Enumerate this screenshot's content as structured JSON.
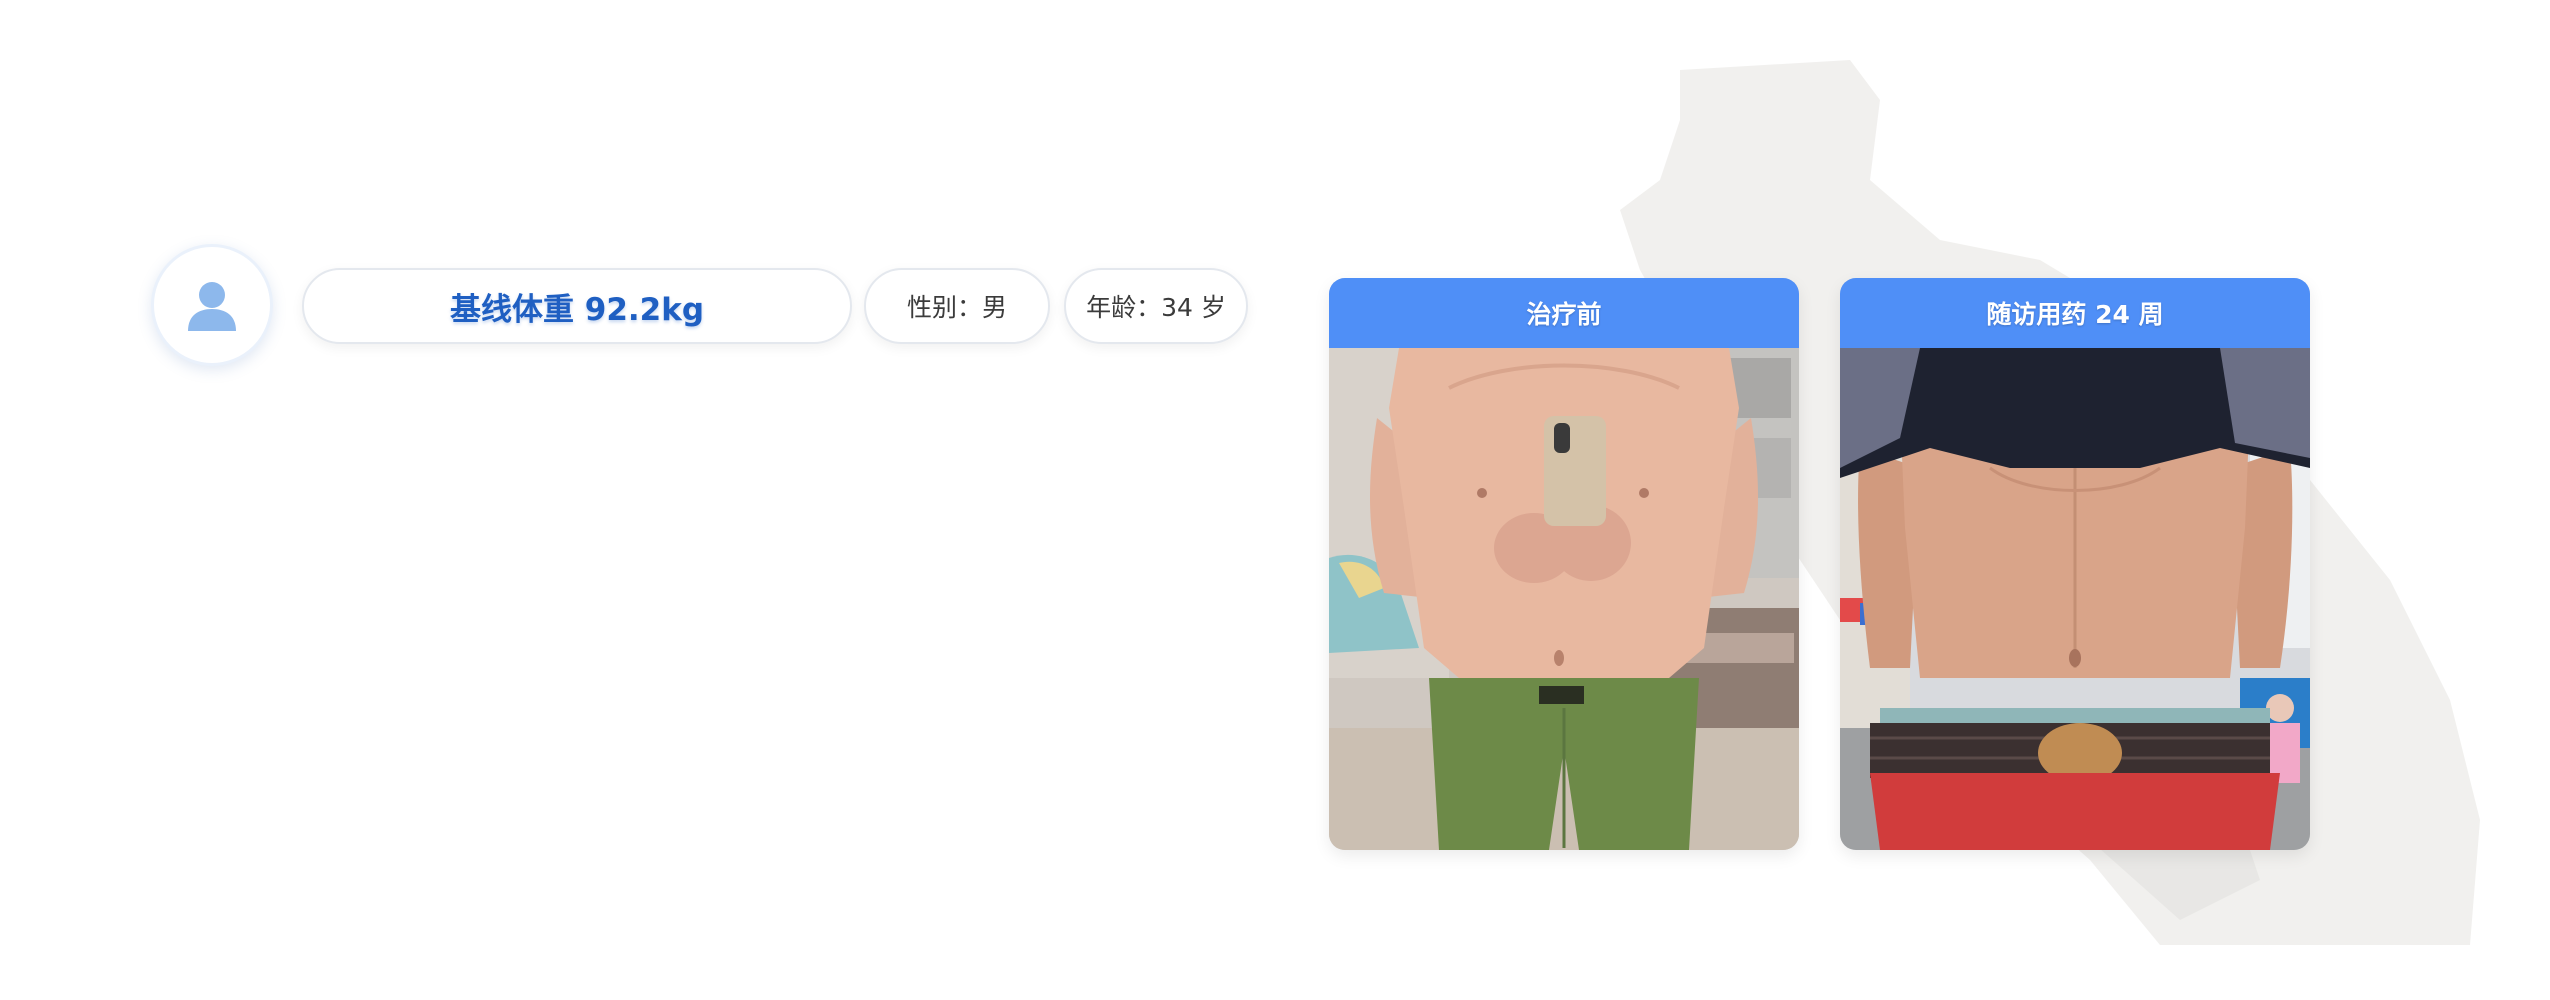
{
  "patient": {
    "avatar_icon": "user-silhouette-icon",
    "baseline_weight": "基线体重 92.2kg",
    "gender": "性别：男",
    "age": "年龄：34 岁"
  },
  "photos": {
    "before": {
      "title": "治疗前",
      "image": "torso-before-treatment-photo"
    },
    "after": {
      "title": "随访用药 24 周",
      "image": "torso-after-24-weeks-photo"
    }
  },
  "colors": {
    "accent_blue": "#4f8ff7",
    "weight_text": "#1f5fc2",
    "avatar_icon": "#8db8ec"
  }
}
